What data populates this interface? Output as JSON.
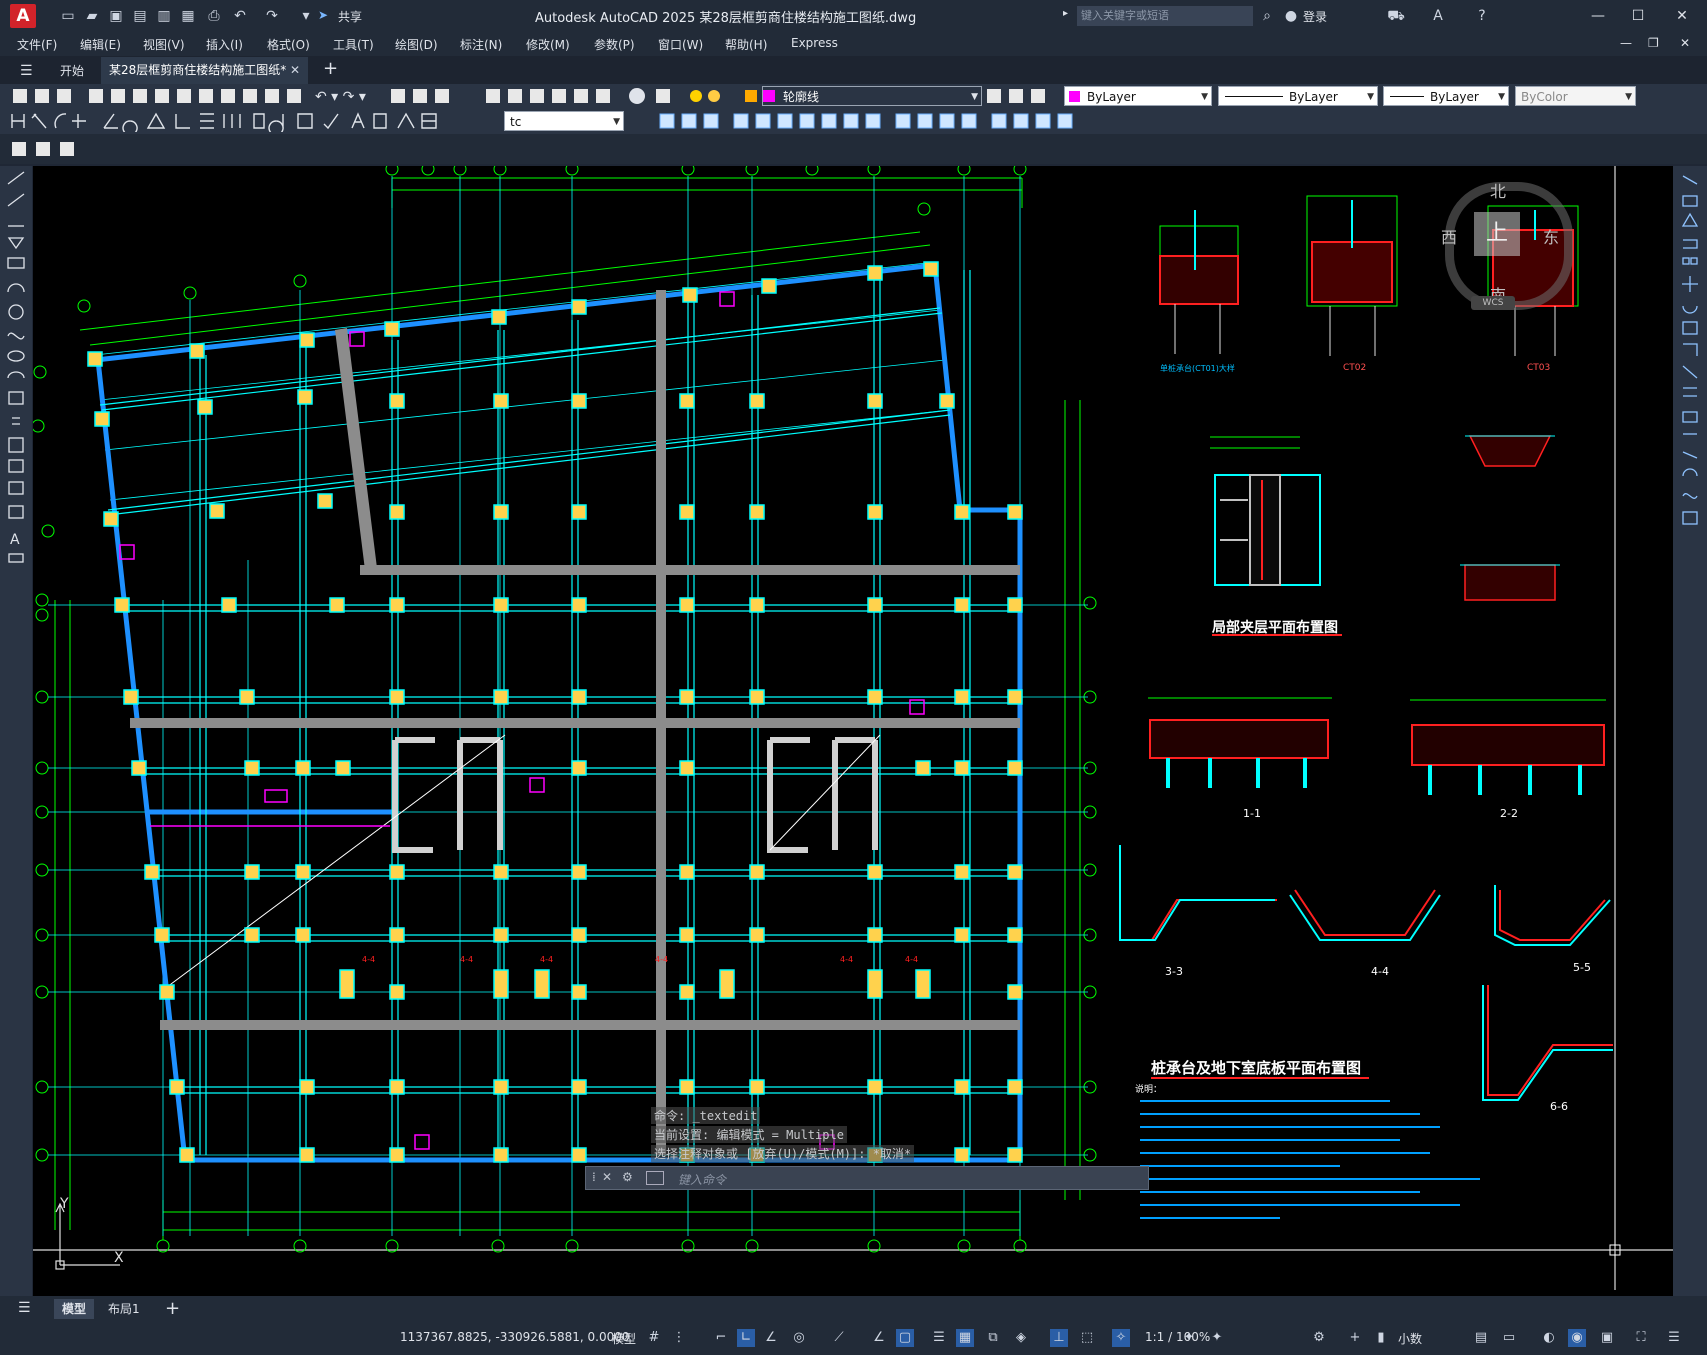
{
  "app": {
    "logo": "A",
    "title": "Autodesk AutoCAD 2025    某28层框剪商住楼结构施工图纸.dwg",
    "share": "共享",
    "search_placeholder": "键入关键字或短语",
    "login": "登录"
  },
  "menu": [
    "文件(F)",
    "编辑(E)",
    "视图(V)",
    "插入(I)",
    "格式(O)",
    "工具(T)",
    "绘图(D)",
    "标注(N)",
    "修改(M)",
    "参数(P)",
    "窗口(W)",
    "帮助(H)",
    "Express"
  ],
  "tabs": {
    "start": "开始",
    "doc": "某28层框剪商住楼结构施工图纸*"
  },
  "layer": {
    "current_layer": "轮廓线",
    "color": "ByLayer",
    "linetype": "ByLayer",
    "lineweight": "ByLayer",
    "plotstyle": "ByColor",
    "text_style": "tc"
  },
  "viewcube": {
    "north": "北",
    "south": "南",
    "east": "东",
    "west": "西",
    "top": "上",
    "wcs": "WCS"
  },
  "drawing_titles": {
    "main_plan": "桩承台及地下室底板平面布置图",
    "mezzanine": "局部夹层平面布置图",
    "note_label": "说明："
  },
  "details": {
    "ct01": "单桩承台(CT01)大样",
    "ct02": "CT02",
    "ct03": "CT03",
    "sec11": "1-1",
    "sec22": "2-2",
    "sec33": "3-3",
    "sec44": "4-4",
    "sec55": "5-5",
    "sec66": "6-6"
  },
  "command": {
    "hist1": "命令: _textedit",
    "hist2": "当前设置: 编辑模式 = Multiple",
    "hist3": "选择注释对象或 [放弃(U)/模式(M)]: *取消*",
    "placeholder": "键入命令"
  },
  "layout_tabs": {
    "model": "模型",
    "layout1": "布局1"
  },
  "status": {
    "coords": "1137367.8825, -330926.5881, 0.0000",
    "space": "模型",
    "scale": "1:1 / 100%",
    "units": "小数"
  },
  "colors": {
    "frame": "#00ff00",
    "column": "#00ffff",
    "beam": "#1e90ff",
    "wall": "#c0c0c0",
    "highlight": "#ff00ff",
    "rebar": "#ff2020",
    "note": "#00a0ff"
  }
}
